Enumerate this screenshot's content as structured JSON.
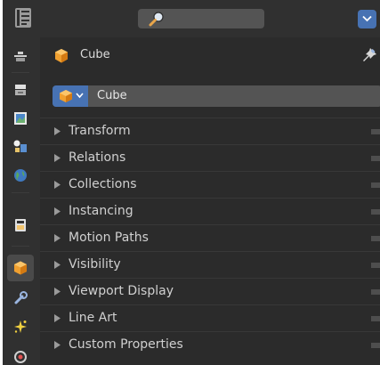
{
  "header": {
    "search_placeholder": "",
    "accent_color": "#4772b3"
  },
  "tabs": [
    {
      "name": "tool",
      "icon": "tool-icon",
      "active": false
    },
    {
      "name": "render",
      "icon": "render-icon",
      "active": false
    },
    {
      "name": "output",
      "icon": "output-icon",
      "active": false
    },
    {
      "name": "view-layer",
      "icon": "view-layer-icon",
      "active": false
    },
    {
      "name": "scene",
      "icon": "scene-icon",
      "active": false
    },
    {
      "name": "world",
      "icon": "world-icon",
      "active": false
    },
    {
      "name": "collection",
      "icon": "collection-icon",
      "active": false
    },
    {
      "name": "object",
      "icon": "object-cube-icon",
      "active": true
    },
    {
      "name": "modifiers",
      "icon": "wrench-icon",
      "active": false
    },
    {
      "name": "particles",
      "icon": "particles-icon",
      "active": false
    },
    {
      "name": "physics",
      "icon": "physics-icon",
      "active": false
    }
  ],
  "context": {
    "object_name": "Cube"
  },
  "name_field": {
    "value": "Cube"
  },
  "sections": [
    {
      "label": "Transform"
    },
    {
      "label": "Relations"
    },
    {
      "label": "Collections"
    },
    {
      "label": "Instancing"
    },
    {
      "label": "Motion Paths"
    },
    {
      "label": "Visibility"
    },
    {
      "label": "Viewport Display"
    },
    {
      "label": "Line Art"
    },
    {
      "label": "Custom Properties"
    }
  ]
}
